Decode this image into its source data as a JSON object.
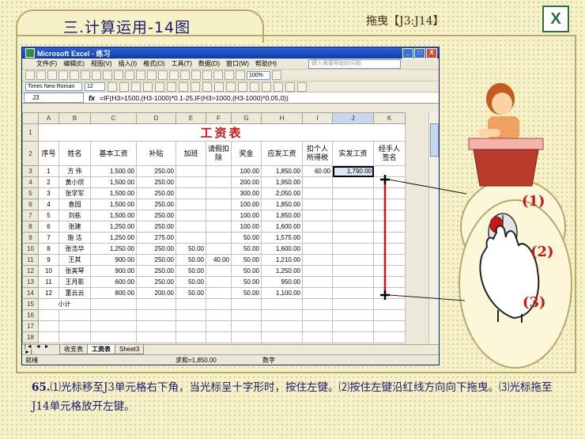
{
  "slide": {
    "title": "三.计算运用-14图",
    "drag_range_label": "拖曳【J3:J14】",
    "excel_badge": "X",
    "step_labels": [
      "(1)",
      "(2)",
      "(3)"
    ],
    "description_number": "65.",
    "description": "⑴光标移至J3单元格右下角，当光标呈十字形时，按住左键。⑵按住左键沿红线方向向下拖曳。⑶光标拖至J14单元格放开左键。"
  },
  "excel": {
    "window_title": "Microsoft Excel - 练习",
    "window_buttons": [
      "_",
      "□",
      "X"
    ],
    "menus": [
      "文件(F)",
      "编辑(E)",
      "视图(V)",
      "插入(I)",
      "格式(O)",
      "工具(T)",
      "数据(D)",
      "窗口(W)",
      "帮助(H)"
    ],
    "help_placeholder": "键入需要帮助的问题",
    "font_name": "Times New Roman",
    "font_size": "12",
    "zoom": "100%",
    "name_box": "J3",
    "fx_label": "fx",
    "formula": "=IF(H3>1500,(H3-1000)*0.1-25,IF(H3>1000,(H3-1000)*0.05,0))",
    "column_headers": [
      "A",
      "B",
      "C",
      "D",
      "E",
      "F",
      "G",
      "H",
      "I",
      "J",
      "K"
    ],
    "sheet_title": "工资表",
    "table_headers": [
      "序号",
      "姓名",
      "基本工资",
      "补贴",
      "加班",
      "请假扣除",
      "奖金",
      "应发工资",
      "扣个人所得税",
      "实发工资",
      "经手人签名"
    ],
    "rows": [
      {
        "row": "3",
        "cells": [
          "1",
          "方 伟",
          "1,500.00",
          "250.00",
          "",
          "",
          "100.00",
          "1,850.00",
          "60.00",
          "1,790.00",
          ""
        ]
      },
      {
        "row": "4",
        "cells": [
          "2",
          "黄小欣",
          "1,500.00",
          "250.00",
          "",
          "",
          "200.00",
          "1,950.00",
          "",
          "",
          ""
        ]
      },
      {
        "row": "5",
        "cells": [
          "3",
          "张学军",
          "1,500.00",
          "250.00",
          "",
          "",
          "300.00",
          "2,050.00",
          "",
          "",
          ""
        ]
      },
      {
        "row": "6",
        "cells": [
          "4",
          "袁园",
          "1,500.00",
          "250.00",
          "",
          "",
          "100.00",
          "1,850.00",
          "",
          "",
          ""
        ]
      },
      {
        "row": "7",
        "cells": [
          "5",
          "刘栋",
          "1,500.00",
          "250.00",
          "",
          "",
          "100.00",
          "1,850.00",
          "",
          "",
          ""
        ]
      },
      {
        "row": "8",
        "cells": [
          "6",
          "张建",
          "1,250.00",
          "250.00",
          "",
          "",
          "100.00",
          "1,600.00",
          "",
          "",
          ""
        ]
      },
      {
        "row": "9",
        "cells": [
          "7",
          "施 洁",
          "1,250.00",
          "275.00",
          "",
          "",
          "50.00",
          "1,575.00",
          "",
          "",
          ""
        ]
      },
      {
        "row": "10",
        "cells": [
          "8",
          "张浩华",
          "1,250.00",
          "250.00",
          "50.00",
          "",
          "50.00",
          "1,600.00",
          "",
          "",
          ""
        ]
      },
      {
        "row": "11",
        "cells": [
          "9",
          "王其",
          "900.00",
          "250.00",
          "50.00",
          "40.00",
          "50.00",
          "1,210.00",
          "",
          "",
          ""
        ]
      },
      {
        "row": "12",
        "cells": [
          "10",
          "张美琴",
          "900.00",
          "250.00",
          "50.00",
          "",
          "50.00",
          "1,250.00",
          "",
          "",
          ""
        ]
      },
      {
        "row": "13",
        "cells": [
          "11",
          "王月影",
          "600.00",
          "250.00",
          "50.00",
          "",
          "50.00",
          "950.00",
          "",
          "",
          ""
        ]
      },
      {
        "row": "14",
        "cells": [
          "12",
          "董云云",
          "800.00",
          "200.00",
          "50.00",
          "",
          "50.00",
          "1,100.00",
          "",
          "",
          ""
        ]
      }
    ],
    "subtotal_label": "小计",
    "row_numbers": [
      "1",
      "2",
      "3",
      "4",
      "5",
      "6",
      "7",
      "8",
      "9",
      "10",
      "11",
      "12",
      "13",
      "14",
      "15",
      "16",
      "17",
      "18"
    ],
    "sheet_tabs": [
      "收支表",
      "工资表",
      "Sheet3"
    ],
    "active_sheet": "工资表",
    "status_left": "就绪",
    "status_sum": "求和=1,850.00",
    "status_num": "数字"
  },
  "colors": {
    "accent_red": "#d01414",
    "title_blue": "#1a1a6e"
  }
}
